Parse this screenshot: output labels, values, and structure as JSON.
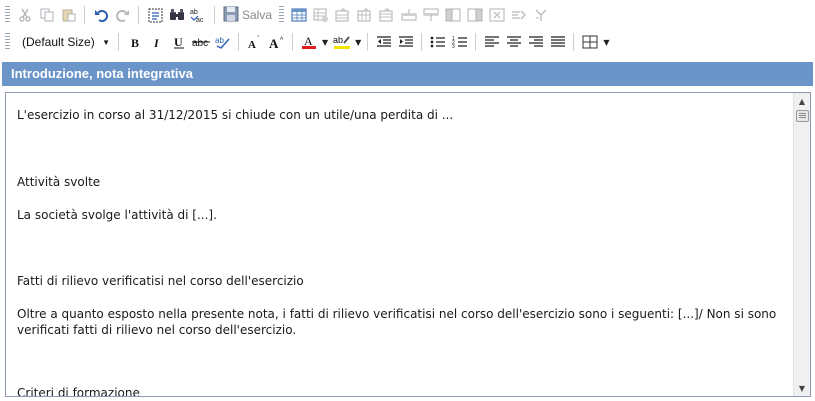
{
  "toolbar": {
    "save_label": "Salva",
    "font_size_value": "(Default Size)"
  },
  "section": {
    "title": "Introduzione, nota integrativa"
  },
  "editor": {
    "paragraphs": [
      "L'esercizio in corso al 31/12/2015 si chiude con un utile/una perdita di ...",
      "Attività svolte",
      "La società svolge l'attività di [...].",
      "Fatti di rilievo verificatisi nel corso dell'esercizio",
      "Oltre a quanto esposto nella presente nota, i fatti di rilievo verificatisi nel corso dell'esercizio sono i seguenti: [...]/ Non si sono verificati fatti di rilievo nel corso dell'esercizio.",
      "Criteri di formazione"
    ]
  },
  "colors": {
    "header_bg": "#6b94c8",
    "font_color_bar": "#e02020",
    "highlight_bar": "#f2e600"
  },
  "icons": {
    "row1": [
      "cut-icon",
      "copy-icon",
      "paste-icon",
      "undo-icon",
      "redo-icon",
      "select-all-icon",
      "find-icon",
      "spellcheck-icon",
      "save-icon",
      "insert-table-icon",
      "table-properties-icon",
      "row-properties-icon",
      "cell-properties-icon",
      "insert-row-icon",
      "delete-row-icon",
      "insert-column-left-icon",
      "insert-column-right-icon",
      "delete-column-icon",
      "merge-cells-icon",
      "split-cell-icon"
    ],
    "row2": [
      "bold-icon",
      "italic-icon",
      "underline-icon",
      "strikethrough-icon",
      "format-painter-icon",
      "shrink-font-icon",
      "grow-font-icon",
      "font-color-icon",
      "highlight-color-icon",
      "decrease-indent-icon",
      "increase-indent-icon",
      "bullet-list-icon",
      "numbered-list-icon",
      "align-left-icon",
      "align-center-icon",
      "align-right-icon",
      "justify-icon",
      "borders-icon"
    ]
  }
}
